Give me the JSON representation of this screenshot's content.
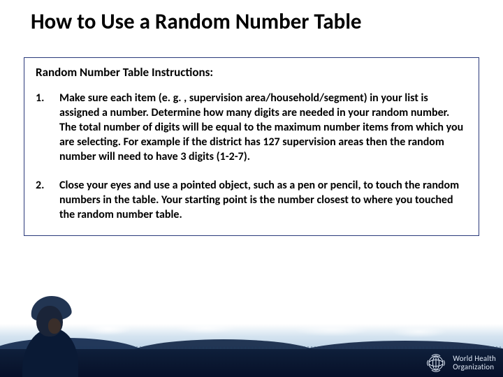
{
  "title": "How to Use a Random Number Table",
  "box": {
    "heading": "Random Number Table Instructions:",
    "items": [
      {
        "num": "1.",
        "text": "Make sure each item (e. g. , supervision area/household/segment) in your list is assigned a number.  Determine how many digits are needed in your random number. The total number of digits will be equal to the maximum number items from which you are selecting.   For example if the district has 127 supervision areas then the random number will need to have 3 digits (1-2-7)."
      },
      {
        "num": "2.",
        "text": "Close your eyes and use a pointed object, such as a pen or pencil, to touch the random numbers in the table. Your starting point is the number closest to where you touched the random number table."
      }
    ]
  },
  "footer": {
    "org_line1": "World Health",
    "org_line2": "Organization"
  }
}
